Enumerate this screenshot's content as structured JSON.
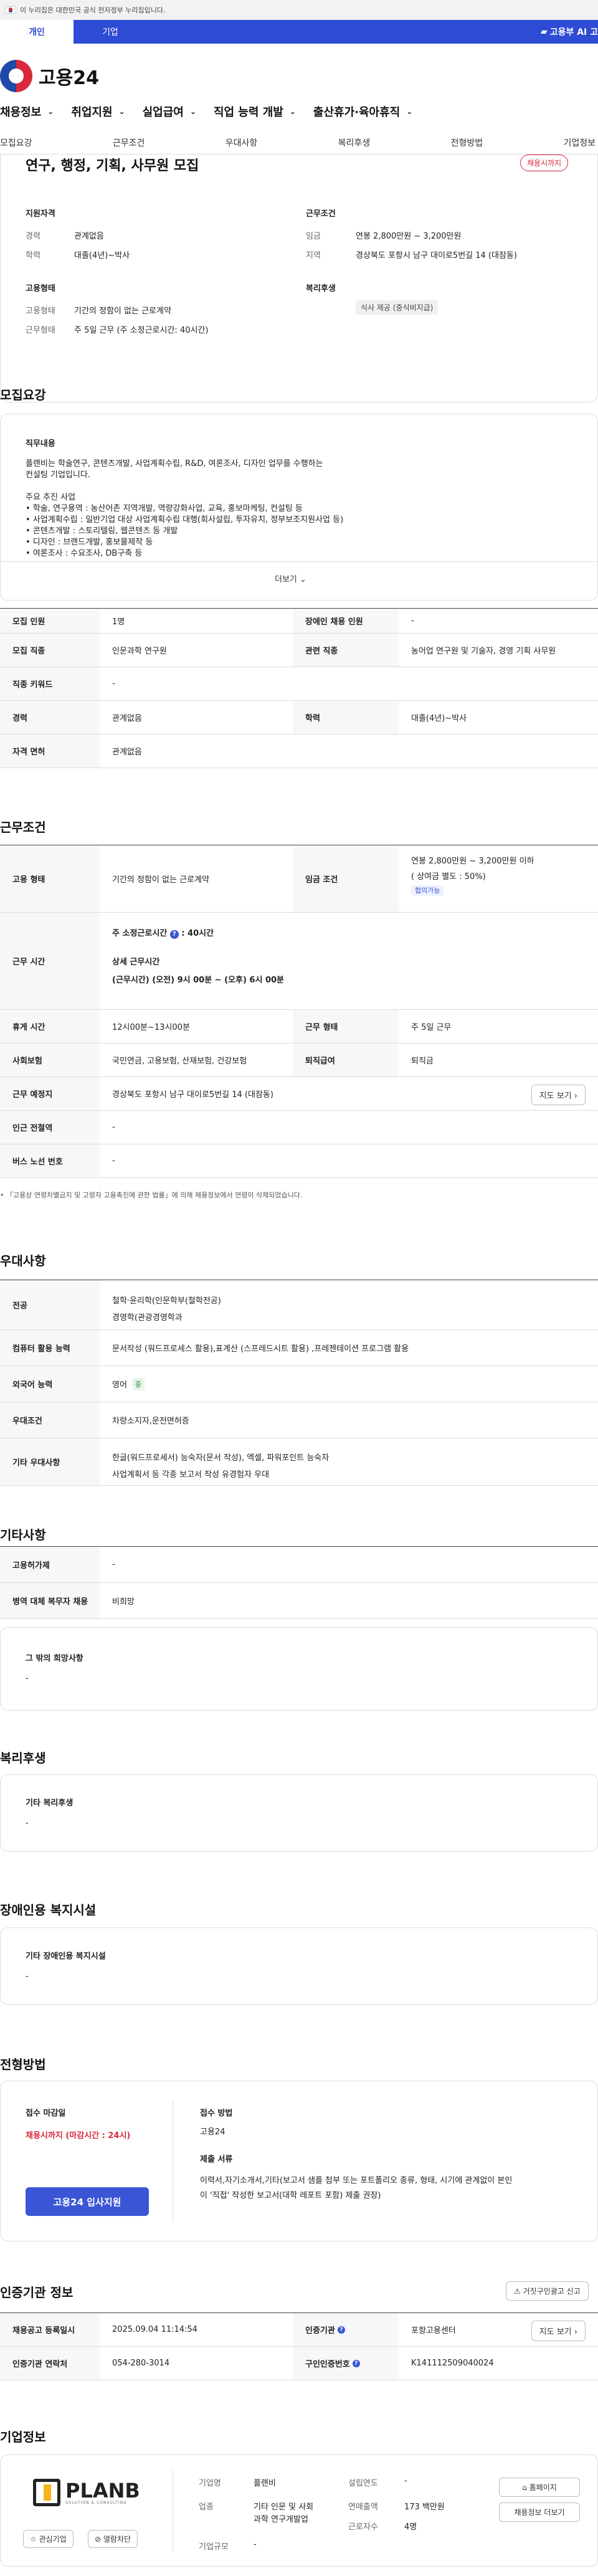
{
  "gov_banner": "이 누리집은 대한민국 공식 전자정부 누리집입니다.",
  "tabs": {
    "personal": "개인",
    "company": "기업",
    "right": "고용부 AI 고"
  },
  "logo": "고용24",
  "gnb": [
    "채용정보",
    "취업지원",
    "실업급여",
    "직업 능력 개발",
    "출산휴가·육아휴직"
  ],
  "subtabs": [
    "모집요강",
    "근무조건",
    "우대사항",
    "복리후생",
    "전형방법",
    "기업정보"
  ],
  "header": {
    "title": "연구, 행정, 기획, 사무원 모집",
    "badge": "채용시까지",
    "qual_title": "지원자격",
    "exp_label": "경력",
    "exp_value": "관계없음",
    "edu_label": "학력",
    "edu_value": "대졸(4년)~박사",
    "cond_title": "근무조건",
    "wage_label": "임금",
    "wage_value": "연봉 2,800만원 ~ 3,200만원",
    "region_label": "지역",
    "region_value": "경상북도 포항시 남구 대이로5번길 14 (대잠동)",
    "emp_title": "고용형태",
    "emp_label": "고용형태",
    "emp_value": "기간의 정함이 없는 근로계약",
    "work_label": "근무형태",
    "work_value": "주 5일 근무 (주 소정근로시간: 40시간)",
    "welfare_title": "복리후생",
    "welfare_chip": "식사 제공 (중식비지급)"
  },
  "recruit": {
    "heading": "모집요강",
    "job_title": "직무내용",
    "desc1": "플랜비는 학술연구, 콘텐츠개발, 사업계획수립, R&D, 여론조사, 디자인 업무를 수행하는",
    "desc2": "컨설팅 기업입니다.",
    "main_title": "주요 추진 사업",
    "items": [
      "• 학술, 연구용역 : 농산어촌 지역개발, 역량강화사업, 교육, 홍보마케팅, 컨설팅 등",
      "• 사업계획수립 : 일반기업 대상 사업계획수립 대행(회사설립, 투자유치, 정부보조지원사업 등)",
      "• 콘텐츠개발 : 스토리텔링, 웹콘텐츠 등 개발",
      "• 디자인 : 브랜드개발, 홍보물제작 등",
      "• 여론조사 : 수요조사, DB구축 등"
    ],
    "more": "더보기"
  },
  "recruit_table": {
    "count_k": "모집 인원",
    "count_v": "1명",
    "disabled_k": "장애인 채용 인원",
    "disabled_v": "-",
    "job_k": "모집 직종",
    "job_v": "인문과학 연구원",
    "rel_k": "관련 직종",
    "rel_v": "농어업 연구원 및 기술자, 경영 기획 사무원",
    "kw_k": "직종 키워드",
    "kw_v": "-",
    "exp_k": "경력",
    "exp_v": "관계없음",
    "edu_k": "학력",
    "edu_v": "대졸(4년)~박사",
    "lic_k": "자격 면허",
    "lic_v": "관계없음"
  },
  "cond": {
    "heading": "근무조건",
    "emp_k": "고용 형태",
    "emp_v": "기간의 정함이 없는 근로계약",
    "wage_k": "임금 조건",
    "wage_v1": "연봉 2,800만원 ~ 3,200만원 이하",
    "wage_v2": "( 상여금 별도 : 50%)",
    "wage_chip": "협의가능",
    "time_k": "근무 시간",
    "time_v1": "주 소정근로시간",
    "time_v1b": ": 40시간",
    "time_v2": "상세 근무시간",
    "time_v3": "(근무시간) (오전) 9시 00분 ~ (오후) 6시 00분",
    "rest_k": "휴게 시간",
    "rest_v": "12시00분~13시00분",
    "form_k": "근무 형태",
    "form_v": "주 5일 근무",
    "ins_k": "사회보험",
    "ins_v": "국민연금, 고용보험, 산재보험, 건강보험",
    "ret_k": "퇴직급여",
    "ret_v": "퇴직금",
    "place_k": "근무 예정지",
    "place_v": "경상북도 포항시 남구 대이로5번길 14 (대잠동)",
    "map_btn": "지도 보기",
    "sub_k": "인근 전철역",
    "sub_v": "-",
    "bus_k": "버스 노선 번호",
    "bus_v": "-",
    "note": "• 「고용상 연령차별금지 및 고령자 고용촉진에 관한 법률」에 의해 채용정보에서 연령이 삭제되었습니다."
  },
  "pref": {
    "heading": "우대사항",
    "major_k": "전공",
    "major_v1": "철학·윤리학(인문학부(철학전공)",
    "major_v2": "경영학(관광경영학과",
    "pc_k": "컴퓨터 활용 능력",
    "pc_v": "문서작성 (워드프로세스 활용),표계산 (스프레드시트 활용) ,프레젠테이션 프로그램 활용",
    "lang_k": "외국어 능력",
    "lang_v": "영어",
    "lang_chip": "중",
    "pref_k": "우대조건",
    "pref_v": "차량소지자,운전면허증",
    "etc_k": "기타 우대사항",
    "etc_v1": "한글(워드프로세서) 능숙자(문서 작성), 엑셀, 파워포인트 능숙자",
    "etc_v2": "사업계획서 등 각종 보고서 작성 유경험자 우대"
  },
  "other": {
    "heading": "기타사항",
    "hire_k": "고용허가제",
    "hire_v": "-",
    "mil_k": "병역 대체 복무자 채용",
    "mil_v": "비희망",
    "extra_title": "그 밖의 희망사항",
    "extra_v": "-"
  },
  "welfare": {
    "heading": "복리후생",
    "title": "기타 복리후생",
    "value": "-"
  },
  "disabled": {
    "heading": "장애인용 복지시설",
    "title": "기타 장애인용 복지시설",
    "value": "-"
  },
  "process": {
    "heading": "전형방법",
    "deadline_label": "접수 마감일",
    "deadline_value": "채용시까지 (마감시간 : 24시)",
    "apply_btn": "고용24 입사지원",
    "method_label": "접수 방법",
    "method_value": "고용24",
    "docs_label": "제출 서류",
    "docs_value1": "이력서,자기소개서,기타(보고서 샘플 첨부 또는 포트폴리오  종류, 형태, 시기에 관계없이 본인",
    "docs_value2": "이 '직접' 작성한 보고서(대학 레포트 포함) 제출 권장)"
  },
  "agency": {
    "heading": "인증기관 정보",
    "report_btn": "거짓구인광고 신고",
    "reg_k": "채용공고 등록일시",
    "reg_v": "2025.09.04 11:14:54",
    "inst_k": "인증기관",
    "inst_v": "포항고용센터",
    "map_btn": "지도 보기",
    "tel_k": "인증기관 연락처",
    "tel_v": "054-280-3014",
    "num_k": "구인인증번호",
    "num_v": "K141112509040024"
  },
  "company": {
    "heading": "기업정보",
    "logo_text": "PLANB",
    "logo_sub": "SOLUTION & CONSULTING",
    "fav_btn": "관심기업",
    "block_btn": "열람차단",
    "name_k": "기업명",
    "name_v": "플랜비",
    "ind_k": "업종",
    "ind_v1": "기타 인문 및 사회",
    "ind_v2": "과학 연구개발업",
    "size_k": "기업규모",
    "size_v": "-",
    "est_k": "설립연도",
    "est_v": "-",
    "sales_k": "연매출액",
    "sales_v": "173 백만원",
    "emp_k": "근로자수",
    "emp_v": "4명",
    "home_btn": "홈페이지",
    "more_btn": "채용정보 더보기"
  }
}
